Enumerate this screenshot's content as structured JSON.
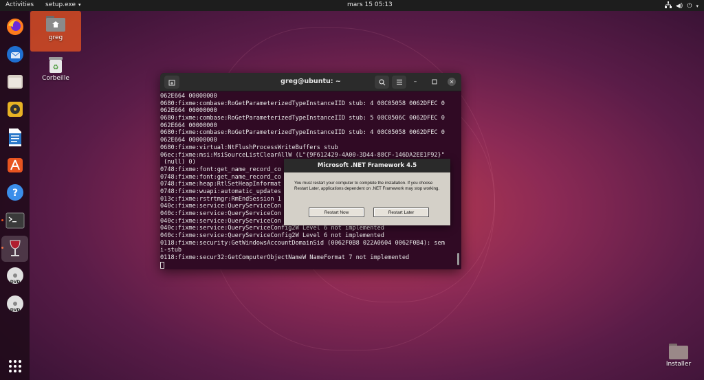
{
  "topbar": {
    "activities": "Activities",
    "app_menu": "setup.exe",
    "clock": "mars 15  05:13"
  },
  "dock": {
    "items": [
      {
        "icon": "firefox-icon"
      },
      {
        "icon": "thunderbird-icon"
      },
      {
        "icon": "files-icon"
      },
      {
        "icon": "rhythmbox-icon"
      },
      {
        "icon": "writer-icon"
      },
      {
        "icon": "software-icon"
      },
      {
        "icon": "help-icon"
      },
      {
        "icon": "terminal-icon"
      },
      {
        "icon": "wine-icon"
      },
      {
        "icon": "dvd-icon"
      },
      {
        "icon": "dvd-icon"
      },
      {
        "icon": "show-apps-icon"
      }
    ]
  },
  "desktop": {
    "home_label": "greg",
    "trash_label": "Corbeille",
    "installer_label": "Installer"
  },
  "terminal": {
    "title": "greg@ubuntu: ~",
    "lines": [
      "062E664 00000000",
      "0680:fixme:combase:RoGetParameterizedTypeInstanceIID stub: 4 08C05058 0062DFEC 0",
      "062E664 00000000",
      "0680:fixme:combase:RoGetParameterizedTypeInstanceIID stub: 5 08C0506C 0062DFEC 0",
      "062E664 00000000",
      "0680:fixme:combase:RoGetParameterizedTypeInstanceIID stub: 4 08C05058 0062DFEC 0",
      "062E664 00000000",
      "0680:fixme:virtual:NtFlushProcessWriteBuffers stub",
      "06ec:fixme:msi:MsiSourceListClearAllW (L\"{9F612429-4A00-3D44-88CF-146DA2EE1F92}\"",
      " (null) 0)",
      "0748:fixme:font:get_name_record_co",
      "0748:fixme:font:get_name_record_co",
      "0748:fixme:heap:RtlSetHeapInformat",
      "0748:fixme:wuapi:automatic_updates",
      "013c:fixme:rstrtmgr:RmEndSession 1",
      "040c:fixme:service:QueryServiceCon",
      "040c:fixme:service:QueryServiceCon",
      "040c:fixme:service:QueryServiceCon",
      "040c:fixme:service:QueryServiceConfig2W Level 6 not implemented",
      "040c:fixme:service:QueryServiceConfig2W Level 6 not implemented",
      "0118:fixme:security:GetWindowsAccountDomainSid (0062F0B8 022A0604 0062F0B4): sem",
      "i-stub",
      "0118:fixme:secur32:GetComputerObjectNameW NameFormat 7 not implemented"
    ]
  },
  "dialog": {
    "title": "Microsoft .NET Framework 4.5",
    "message": "You must restart your computer to complete the installation. If you choose Restart Later, applications dependent on .NET Framework may stop working.",
    "restart_now": "Restart Now",
    "restart_later": "Restart Later"
  }
}
